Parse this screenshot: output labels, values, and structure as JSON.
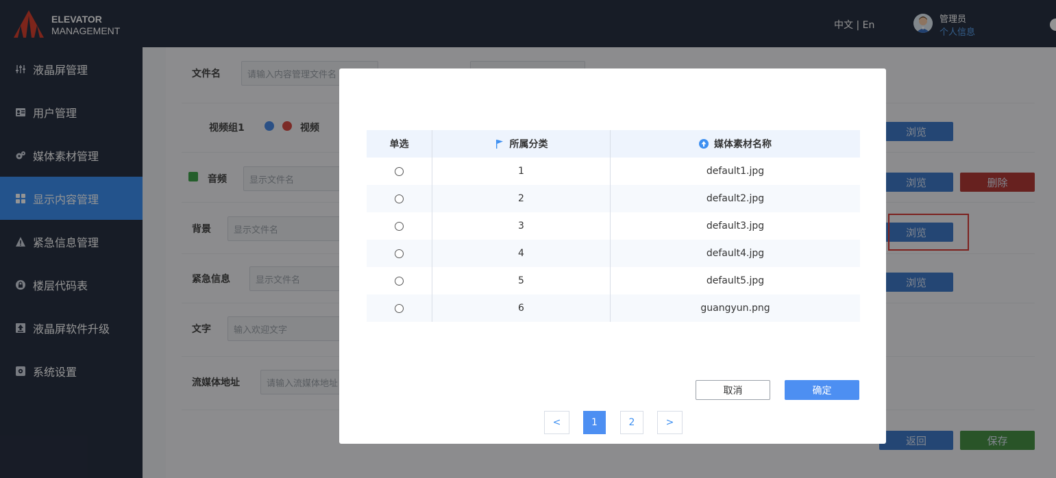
{
  "header": {
    "brand_line1": "ELEVATOR",
    "brand_line2": "MANAGEMENT",
    "lang_switch": "中文 | En",
    "user_role": "管理员",
    "user_info_link": "个人信息"
  },
  "sidebar": {
    "items": [
      {
        "label": "液晶屏管理",
        "icon": "sliders-icon",
        "active": false
      },
      {
        "label": "用户管理",
        "icon": "user-card-icon",
        "active": false
      },
      {
        "label": "媒体素材管理",
        "icon": "media-gear-icon",
        "active": false
      },
      {
        "label": "显示内容管理",
        "icon": "grid-icon",
        "active": true
      },
      {
        "label": "紧急信息管理",
        "icon": "warning-icon",
        "active": false
      },
      {
        "label": "楼层代码表",
        "icon": "lock-icon",
        "active": false
      },
      {
        "label": "液晶屏软件升级",
        "icon": "upload-icon",
        "active": false
      },
      {
        "label": "系统设置",
        "icon": "settings-icon",
        "active": false
      }
    ]
  },
  "form": {
    "filename_label": "文件名",
    "filename_placeholder": "请输入内容管理文件名",
    "video_group_label": "视频组1",
    "video_label": "视频",
    "audio_label": "音频",
    "audio_placeholder": "显示文件名",
    "background_label": "背景",
    "background_placeholder": "显示文件名",
    "emergency_label": "紧急信息",
    "emergency_placeholder": "显示文件名",
    "text_label": "文字",
    "text_placeholder": "输入欢迎文字",
    "stream_label": "流媒体地址",
    "stream_placeholder": "请输入流媒体地址",
    "browse_label": "浏览",
    "delete_label": "删除",
    "back_label": "返回",
    "save_label": "保存"
  },
  "modal": {
    "columns": {
      "select": "单选",
      "category": "所属分类",
      "media_name": "媒体素材名称"
    },
    "rows": [
      {
        "category": "1",
        "name": "default1.jpg"
      },
      {
        "category": "2",
        "name": "default2.jpg"
      },
      {
        "category": "3",
        "name": "default3.jpg"
      },
      {
        "category": "4",
        "name": "default4.jpg"
      },
      {
        "category": "5",
        "name": "default5.jpg"
      },
      {
        "category": "6",
        "name": "guangyun.png"
      }
    ],
    "cancel_label": "取消",
    "confirm_label": "确定",
    "pagination": {
      "prev": "<",
      "pages": [
        "1",
        "2"
      ],
      "current": "1",
      "next": ">"
    }
  },
  "colors": {
    "header_bg": "#293143",
    "accent": "#3d8ff1",
    "confirm": "#4d8ff2",
    "danger": "#b23a36",
    "success": "#479245",
    "highlight": "#d63a34"
  }
}
